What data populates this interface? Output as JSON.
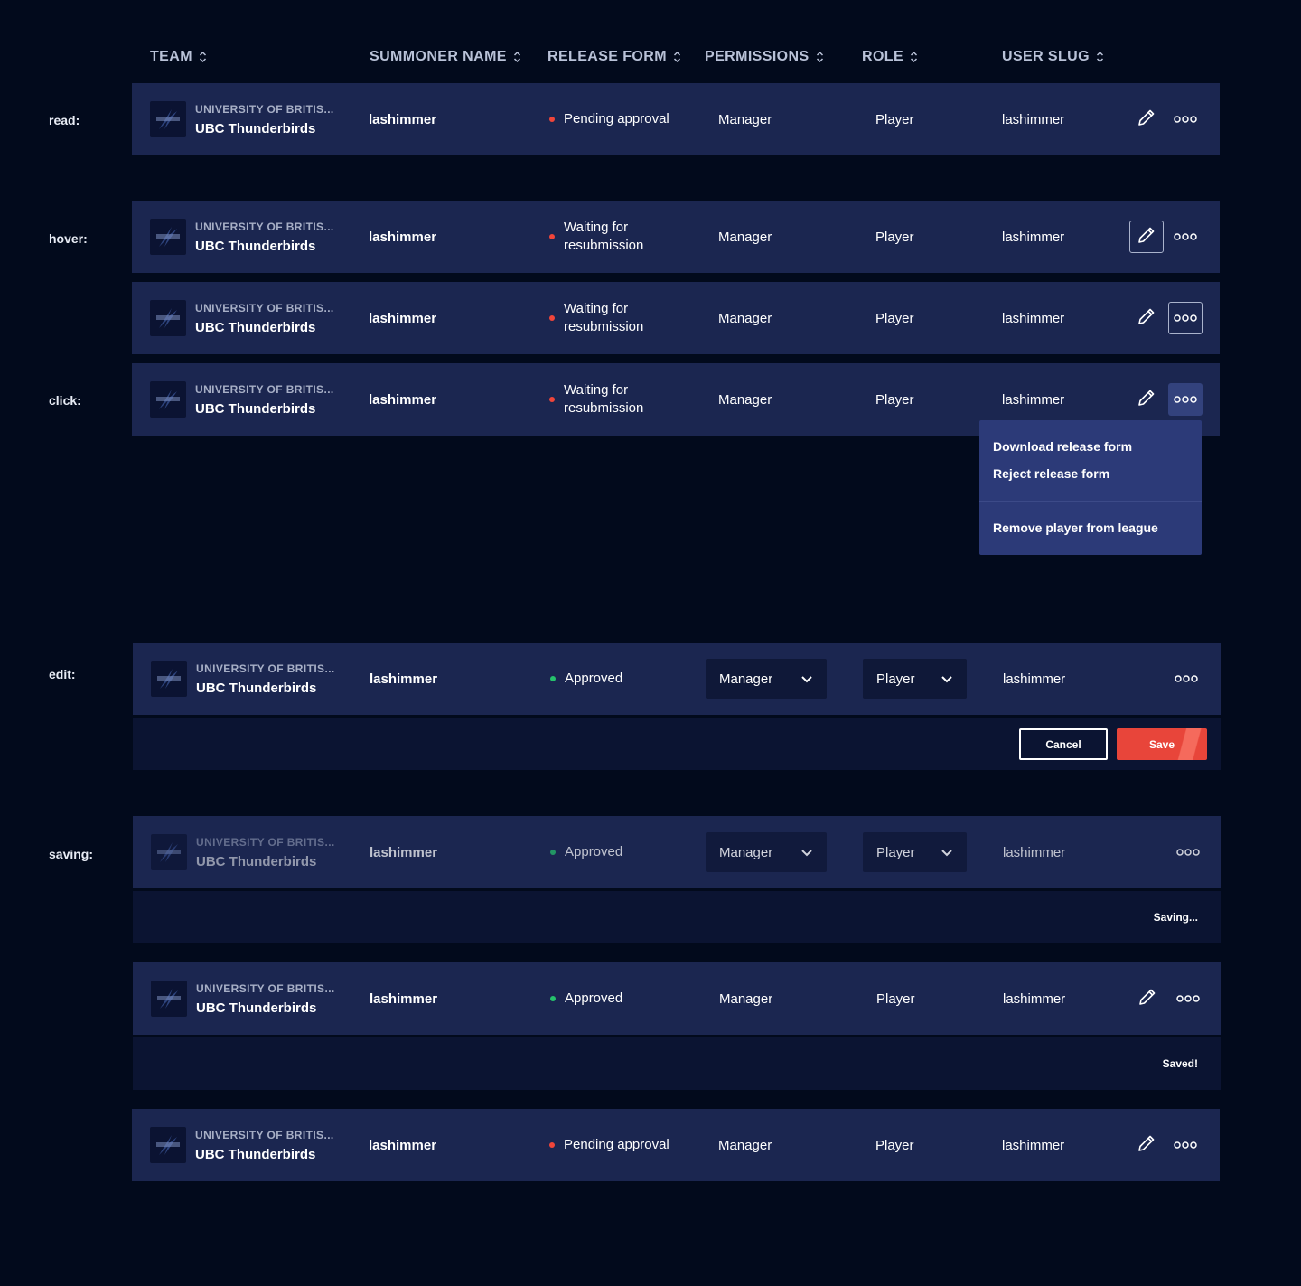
{
  "columns": {
    "team": "TEAM",
    "summoner": "SUMMONER NAME",
    "release_form": "RELEASE FORM",
    "permissions": "PERMISSIONS",
    "role": "ROLE",
    "user_slug": "USER SLUG"
  },
  "states": {
    "read": "read:",
    "hover": "hover:",
    "click": "click:",
    "edit": "edit:",
    "saving": "saving:"
  },
  "team": {
    "university": "UNIVERSITY OF BRITIS...",
    "name": "UBC Thunderbirds"
  },
  "player": {
    "summoner": "lashimmer",
    "permission": "Manager",
    "role": "Player",
    "slug": "lashimmer"
  },
  "statuses": {
    "pending": "Pending approval",
    "waiting": "Waiting for resubmission",
    "approved": "Approved"
  },
  "menu": {
    "download": "Download release form",
    "reject": "Reject release form",
    "remove": "Remove player from league"
  },
  "actions": {
    "cancel": "Cancel",
    "save": "Save",
    "saving": "Saving...",
    "saved": "Saved!"
  },
  "colors": {
    "background": "#020a1c",
    "row": "#1b2650",
    "status_red": "#f0453a",
    "status_green": "#25c26c",
    "save_button": "#e8453a",
    "menu": "#2c3a78"
  },
  "icons": {
    "sort": "sort-icon",
    "edit": "pencil-icon",
    "more": "more-icon",
    "dropdown": "chevron-down-icon"
  }
}
